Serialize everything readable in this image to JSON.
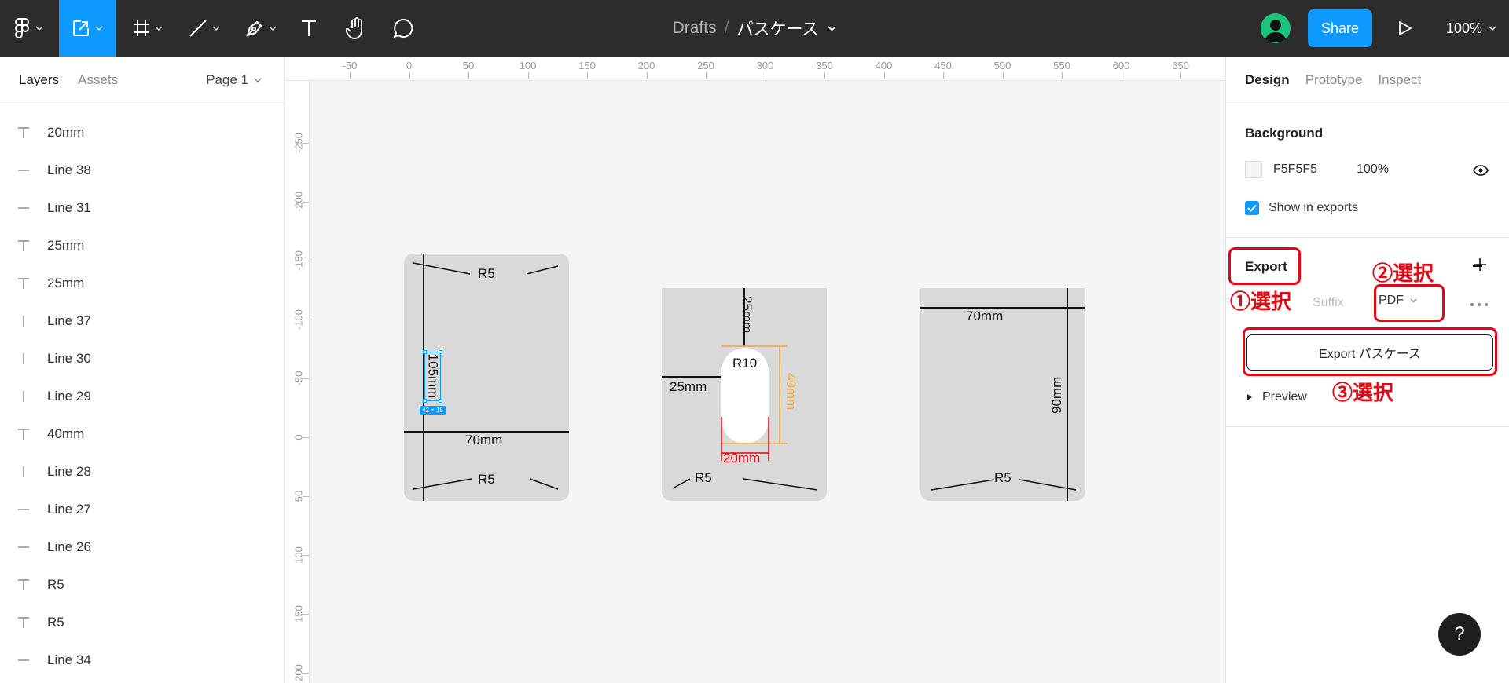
{
  "toolbar": {
    "breadcrumb": "Drafts",
    "separator": "/",
    "file_name": "パスケース",
    "share_label": "Share",
    "zoom_label": "100%",
    "accent_color": "#0d99ff"
  },
  "left_panel": {
    "tabs": [
      "Layers",
      "Assets"
    ],
    "page_label": "Page 1",
    "layers": [
      {
        "icon": "text-icon",
        "label": "20mm"
      },
      {
        "icon": "horizontal-line-icon",
        "label": "Line 38"
      },
      {
        "icon": "horizontal-line-icon",
        "label": "Line 31"
      },
      {
        "icon": "text-icon",
        "label": "25mm"
      },
      {
        "icon": "text-icon",
        "label": "25mm"
      },
      {
        "icon": "vertical-line-icon",
        "label": "Line 37"
      },
      {
        "icon": "vertical-line-icon",
        "label": "Line 30"
      },
      {
        "icon": "vertical-line-icon",
        "label": "Line 29"
      },
      {
        "icon": "text-icon",
        "label": "40mm"
      },
      {
        "icon": "vertical-line-icon",
        "label": "Line 28"
      },
      {
        "icon": "horizontal-line-icon",
        "label": "Line 27"
      },
      {
        "icon": "horizontal-line-icon",
        "label": "Line 26"
      },
      {
        "icon": "text-icon",
        "label": "R5"
      },
      {
        "icon": "text-icon",
        "label": "R5"
      },
      {
        "icon": "horizontal-line-icon",
        "label": "Line 34"
      }
    ]
  },
  "rulers": {
    "top_labels": [
      "-50",
      "0",
      "50",
      "100",
      "150",
      "200",
      "250",
      "300",
      "350",
      "400",
      "450",
      "500",
      "550",
      "600",
      "650"
    ],
    "left_labels": [
      "-250",
      "-200",
      "-150",
      "-100",
      "-50",
      "0",
      "50",
      "100",
      "150",
      "200"
    ]
  },
  "canvas": {
    "frame1": {
      "r5_top": "R5",
      "height_label": "105mm",
      "selection_size": "42 × 15",
      "width_label": "70mm",
      "r5_bottom": "R5"
    },
    "frame2": {
      "top_label": "25mm",
      "radius_label": "R10",
      "side_label": "25mm",
      "slot_height": "40mm",
      "slot_width": "20mm",
      "r5_bottom": "R5",
      "orange": "#f5a623",
      "red": "#e30613"
    },
    "frame3": {
      "width_label": "70mm",
      "height_label": "90mm",
      "r5_bottom": "R5"
    }
  },
  "right_panel": {
    "tabs": [
      "Design",
      "Prototype",
      "Inspect"
    ],
    "background_title": "Background",
    "bg_color_hex": "F5F5F5",
    "bg_opacity": "100%",
    "show_in_exports_label": "Show in exports",
    "export_title": "Export",
    "suffix_placeholder": "Suffix",
    "format": "PDF",
    "export_button_label": "Export パスケース",
    "preview_label": "Preview"
  },
  "annotations": {
    "step1": "①選択",
    "step2": "②選択",
    "step3": "③選択",
    "color": "#e30613"
  },
  "help_label": "?"
}
